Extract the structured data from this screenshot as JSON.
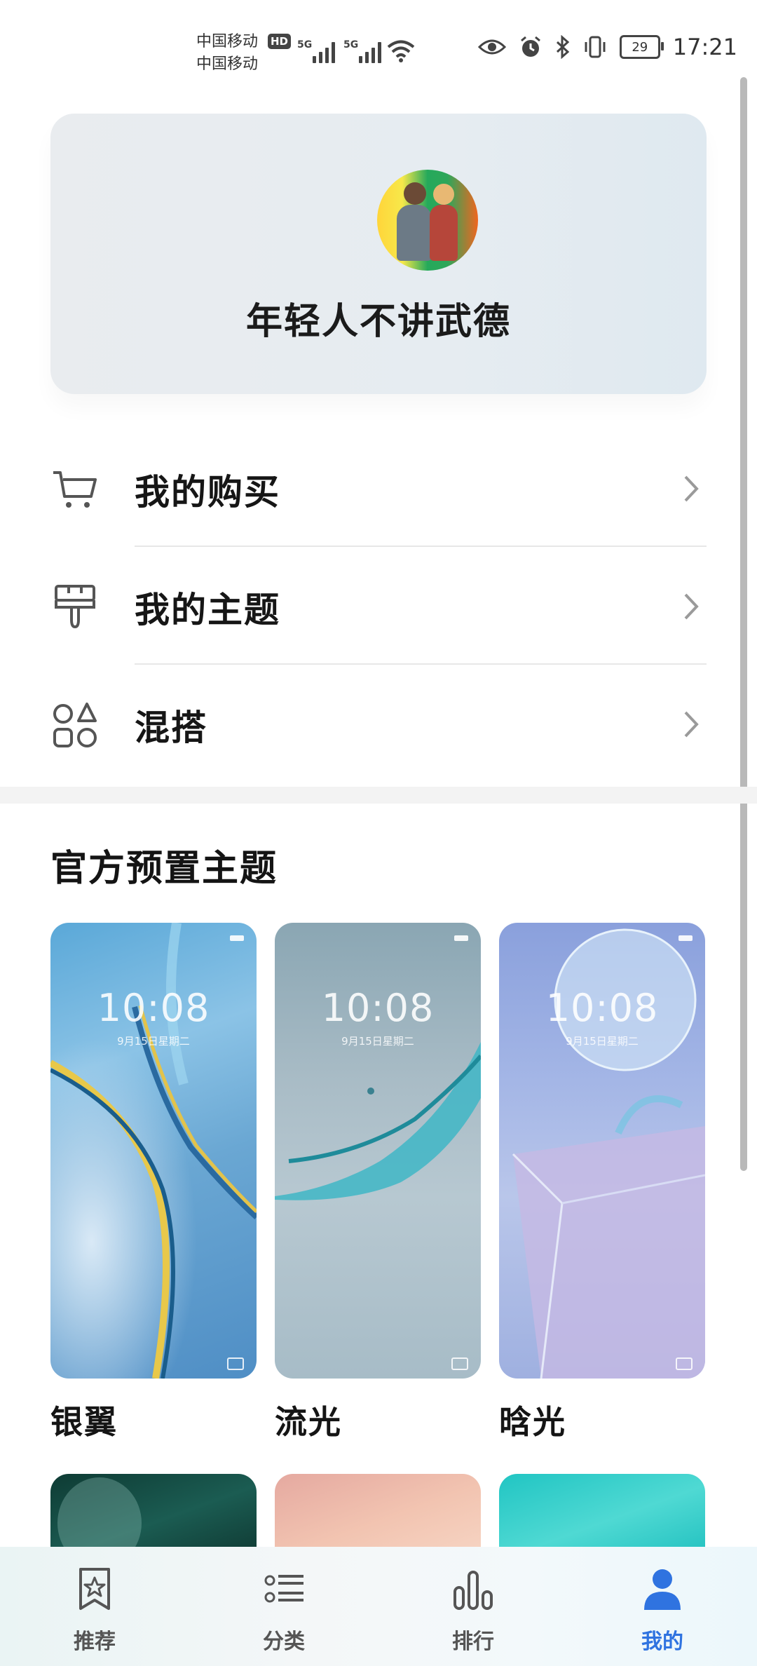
{
  "status_bar": {
    "carrier_1": "中国移动",
    "carrier_2": "中国移动",
    "hd": "HD",
    "net_1": "5G",
    "net_2": "5G",
    "battery": "29",
    "time": "17:21",
    "icons": [
      "wifi-icon",
      "eye-icon",
      "alarm-icon",
      "bluetooth-icon",
      "vibrate-icon",
      "battery-icon"
    ]
  },
  "profile": {
    "name": "年轻人不讲武德"
  },
  "menu": {
    "items": [
      {
        "label": "我的购买",
        "icon": "cart-icon"
      },
      {
        "label": "我的主题",
        "icon": "brush-icon"
      },
      {
        "label": "混搭",
        "icon": "shapes-icon"
      }
    ]
  },
  "section": {
    "title": "官方预置主题"
  },
  "themes": [
    {
      "name": "银翼",
      "clock": "10:08",
      "date": "9月15日星期二"
    },
    {
      "name": "流光",
      "clock": "10:08",
      "date": "9月15日星期二"
    },
    {
      "name": "晗光",
      "clock": "10:08",
      "date": "9月15日星期二"
    }
  ],
  "tabbar": {
    "tabs": [
      {
        "label": "推荐",
        "icon": "star-bookmark-icon"
      },
      {
        "label": "分类",
        "icon": "list-icon"
      },
      {
        "label": "排行",
        "icon": "bar-chart-icon"
      },
      {
        "label": "我的",
        "icon": "person-icon"
      }
    ],
    "active_index": 3,
    "active_color": "#2f73e0"
  }
}
